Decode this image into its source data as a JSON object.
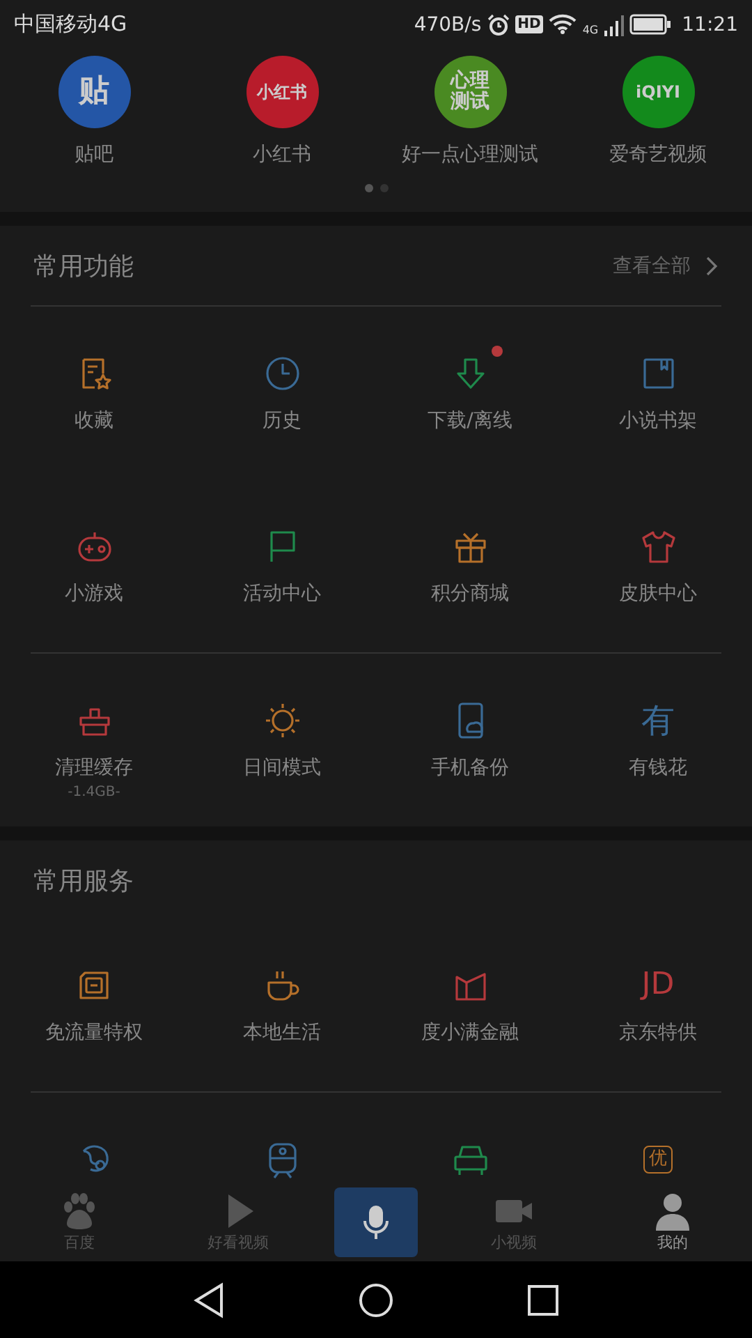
{
  "status_bar": {
    "carrier": "中国移动4G",
    "speed": "470B/s",
    "hd_label": "HD",
    "network_label": "4G",
    "time": "11:21"
  },
  "apps": [
    {
      "label": "贴吧",
      "logo_text": "贴",
      "color": "#2456a6"
    },
    {
      "label": "小红书",
      "logo_text": "小红书",
      "color": "#b81c2b"
    },
    {
      "label": "好一点心理测试",
      "logo_text": "心理测试",
      "color": "#4a8a22"
    },
    {
      "label": "爱奇艺视频",
      "logo_text": "iQIYI",
      "color": "#138a1c"
    }
  ],
  "pager": [
    {
      "selected": true
    },
    {
      "selected": false
    }
  ],
  "functions": {
    "title": "常用功能",
    "more": "查看全部",
    "items": [
      {
        "label": "收藏"
      },
      {
        "label": "历史"
      },
      {
        "label": "下载/离线",
        "badge": true
      },
      {
        "label": "小说书架"
      },
      {
        "label": "小游戏"
      },
      {
        "label": "活动中心"
      },
      {
        "label": "积分商城"
      },
      {
        "label": "皮肤中心"
      },
      {
        "label": "清理缓存",
        "sublabel": "-1.4GB-"
      },
      {
        "label": "日间模式"
      },
      {
        "label": "手机备份"
      },
      {
        "label": "有钱花",
        "icon_text": "有"
      }
    ]
  },
  "services": {
    "title": "常用服务",
    "items": [
      {
        "kind": "full",
        "label": "免流量特权"
      },
      {
        "kind": "full",
        "label": "本地生活"
      },
      {
        "kind": "full",
        "label": "度小满金融"
      },
      {
        "kind": "full",
        "label": "京东特供",
        "icon_text": "JD"
      },
      {
        "kind": "icon_only"
      },
      {
        "kind": "icon_only"
      },
      {
        "kind": "icon_only"
      },
      {
        "kind": "icon_only",
        "icon_text": "优"
      }
    ]
  },
  "bottom_nav": [
    {
      "kind": "tab",
      "label": "百度",
      "selected": false
    },
    {
      "kind": "tab",
      "label": "好看视频",
      "selected": false
    },
    {
      "kind": "voice",
      "selected": false
    },
    {
      "kind": "tab",
      "label": "小视频",
      "selected": false
    },
    {
      "kind": "tab",
      "label": "我的",
      "selected": true
    }
  ]
}
